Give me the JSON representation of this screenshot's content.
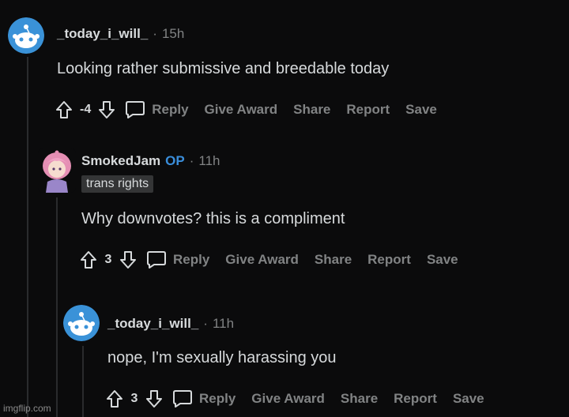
{
  "comments": [
    {
      "username": "_today_i_will_",
      "op_badge": "",
      "separator": "·",
      "time": "15h",
      "flair": "",
      "body": "Looking rather submissive and breedable today",
      "score": "-4",
      "avatar_icon": "reddit-snoo-icon",
      "actions": [
        "Reply",
        "Give Award",
        "Share",
        "Report",
        "Save"
      ]
    },
    {
      "username": "SmokedJam",
      "op_badge": "OP",
      "separator": "·",
      "time": "11h",
      "flair": "trans rights",
      "body": "Why downvotes? this is a compliment",
      "score": "3",
      "avatar_icon": "pink-hair-avatar-icon",
      "actions": [
        "Reply",
        "Give Award",
        "Share",
        "Report",
        "Save"
      ]
    },
    {
      "username": "_today_i_will_",
      "op_badge": "",
      "separator": "·",
      "time": "11h",
      "flair": "",
      "body": "nope, I'm sexually harassing you",
      "score": "3",
      "avatar_icon": "reddit-snoo-icon",
      "actions": [
        "Reply",
        "Give Award",
        "Share",
        "Report",
        "Save"
      ]
    }
  ],
  "icons": {
    "upvote": "upvote-arrow-icon",
    "downvote": "downvote-arrow-icon",
    "reply": "speech-bubble-icon"
  },
  "colors": {
    "background": "#0b0b0c",
    "text": "#d7dadc",
    "muted": "#818384",
    "op_badge": "#3a8edb",
    "flair_bg": "#343536",
    "snoo_blue": "#3a92d8"
  },
  "watermark": "imgflip.com"
}
